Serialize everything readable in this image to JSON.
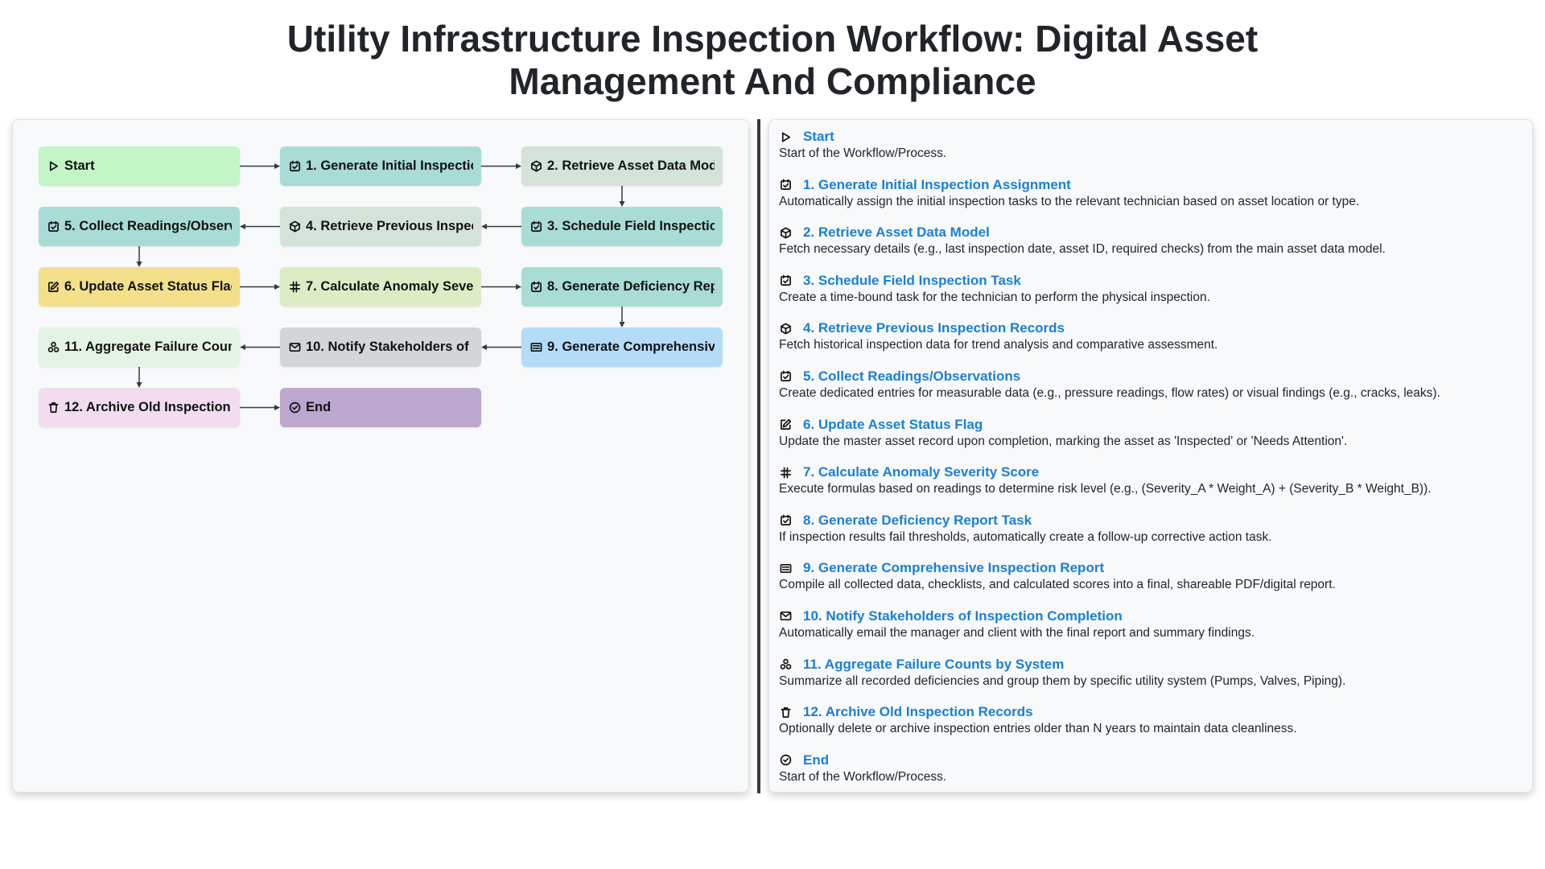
{
  "title": {
    "line1": "Utility Infrastructure Inspection Workflow: Digital Asset",
    "line2": "Management And Compliance"
  },
  "colors": {
    "title_link": "#1a7fd6",
    "arrow": "#343a40"
  },
  "nodes": [
    {
      "id": "start",
      "label": "Start",
      "icon": "play-icon",
      "color": "#c3f5c6"
    },
    {
      "id": "n1",
      "label": "1. Generate Initial Inspection Assignment",
      "icon": "checkbox-icon",
      "color": "#a8dcd4"
    },
    {
      "id": "n2",
      "label": "2. Retrieve Asset Data Model",
      "icon": "cube-icon",
      "color": "#d3e3d8"
    },
    {
      "id": "n3",
      "label": "3. Schedule Field Inspection Task",
      "icon": "checkbox-icon",
      "color": "#a8dcd4"
    },
    {
      "id": "n4",
      "label": "4. Retrieve Previous Inspection Records",
      "icon": "cube-icon",
      "color": "#d3e3d8"
    },
    {
      "id": "n5",
      "label": "5. Collect Readings/Observations",
      "icon": "checkbox-icon",
      "color": "#a8dcd4"
    },
    {
      "id": "n6",
      "label": "6. Update Asset Status Flag",
      "icon": "edit-icon",
      "color": "#f4e08a"
    },
    {
      "id": "n7",
      "label": "7. Calculate Anomaly Severity Score",
      "icon": "hash-icon",
      "color": "#dcedc6"
    },
    {
      "id": "n8",
      "label": "8. Generate Deficiency Report Task",
      "icon": "checkbox-icon",
      "color": "#a8dcd4"
    },
    {
      "id": "n9",
      "label": "9. Generate Comprehensive Inspection Report",
      "icon": "report-icon",
      "color": "#b4dcf8"
    },
    {
      "id": "n10",
      "label": "10. Notify Stakeholders of Inspection Completion",
      "icon": "mail-icon",
      "color": "#d2d6da"
    },
    {
      "id": "n11",
      "label": "11. Aggregate Failure Counts by System",
      "icon": "cluster-icon",
      "color": "#e4f4e4"
    },
    {
      "id": "n12",
      "label": "12. Archive Old Inspection Records",
      "icon": "trash-icon",
      "color": "#f1ddef"
    },
    {
      "id": "end",
      "label": "End",
      "icon": "check-circle-icon",
      "color": "#bca7cf"
    }
  ],
  "descriptions": [
    {
      "title": "Start",
      "icon": "play-icon",
      "text": "Start of the Workflow/Process."
    },
    {
      "title": "1. Generate Initial Inspection Assignment",
      "icon": "checkbox-icon",
      "text": "Automatically assign the initial inspection tasks to the relevant technician based on asset location or type."
    },
    {
      "title": "2. Retrieve Asset Data Model",
      "icon": "cube-icon",
      "text": "Fetch necessary details (e.g., last inspection date, asset ID, required checks) from the main asset data model."
    },
    {
      "title": "3. Schedule Field Inspection Task",
      "icon": "checkbox-icon",
      "text": "Create a time-bound task for the technician to perform the physical inspection."
    },
    {
      "title": "4. Retrieve Previous Inspection Records",
      "icon": "cube-icon",
      "text": "Fetch historical inspection data for trend analysis and comparative assessment."
    },
    {
      "title": "5. Collect Readings/Observations",
      "icon": "checkbox-icon",
      "text": "Create dedicated entries for measurable data (e.g., pressure readings, flow rates) or visual findings (e.g., cracks, leaks)."
    },
    {
      "title": "6. Update Asset Status Flag",
      "icon": "edit-icon",
      "text": "Update the master asset record upon completion, marking the asset as 'Inspected' or 'Needs Attention'."
    },
    {
      "title": "7. Calculate Anomaly Severity Score",
      "icon": "hash-icon",
      "text": "Execute formulas based on readings to determine risk level (e.g., (Severity_A * Weight_A) + (Severity_B * Weight_B))."
    },
    {
      "title": "8. Generate Deficiency Report Task",
      "icon": "checkbox-icon",
      "text": "If inspection results fail thresholds, automatically create a follow-up corrective action task."
    },
    {
      "title": "9. Generate Comprehensive Inspection Report",
      "icon": "report-icon",
      "text": "Compile all collected data, checklists, and calculated scores into a final, shareable PDF/digital report."
    },
    {
      "title": "10. Notify Stakeholders of Inspection Completion",
      "icon": "mail-icon",
      "text": "Automatically email the manager and client with the final report and summary findings."
    },
    {
      "title": "11. Aggregate Failure Counts by System",
      "icon": "cluster-icon",
      "text": "Summarize all recorded deficiencies and group them by specific utility system (Pumps, Valves, Piping)."
    },
    {
      "title": "12. Archive Old Inspection Records",
      "icon": "trash-icon",
      "text": "Optionally delete or archive inspection entries older than N years to maintain data cleanliness."
    },
    {
      "title": "End",
      "icon": "check-circle-icon",
      "text": "Start of the Workflow/Process."
    }
  ]
}
